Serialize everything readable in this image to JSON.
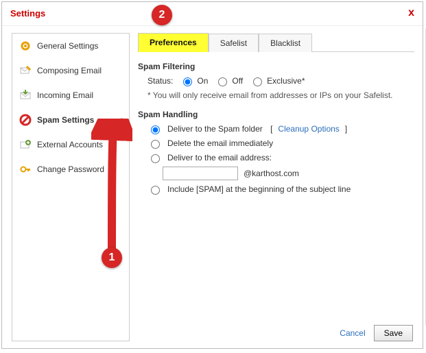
{
  "dialog": {
    "title": "Settings",
    "close_label": "x"
  },
  "sidebar": {
    "items": [
      {
        "label": "General Settings"
      },
      {
        "label": "Composing Email"
      },
      {
        "label": "Incoming Email"
      },
      {
        "label": "Spam Settings"
      },
      {
        "label": "External Accounts"
      },
      {
        "label": "Change Password"
      }
    ]
  },
  "tabs": {
    "preferences": "Preferences",
    "safelist": "Safelist",
    "blacklist": "Blacklist"
  },
  "spam_filtering": {
    "heading": "Spam Filtering",
    "status_label": "Status:",
    "on": "On",
    "off": "Off",
    "exclusive": "Exclusive*",
    "note": "* You will only receive email from addresses or IPs on your Safelist."
  },
  "spam_handling": {
    "heading": "Spam Handling",
    "deliver_spam": "Deliver to the Spam folder",
    "cleanup_link": "Cleanup Options",
    "delete_immediately": "Delete the email immediately",
    "deliver_to_address": "Deliver to the email address:",
    "address_suffix": "@karthost.com",
    "include_spam_tag": "Include [SPAM] at the beginning of the subject line"
  },
  "footer": {
    "cancel": "Cancel",
    "save": "Save"
  },
  "annotations": {
    "one": "1",
    "two": "2"
  }
}
